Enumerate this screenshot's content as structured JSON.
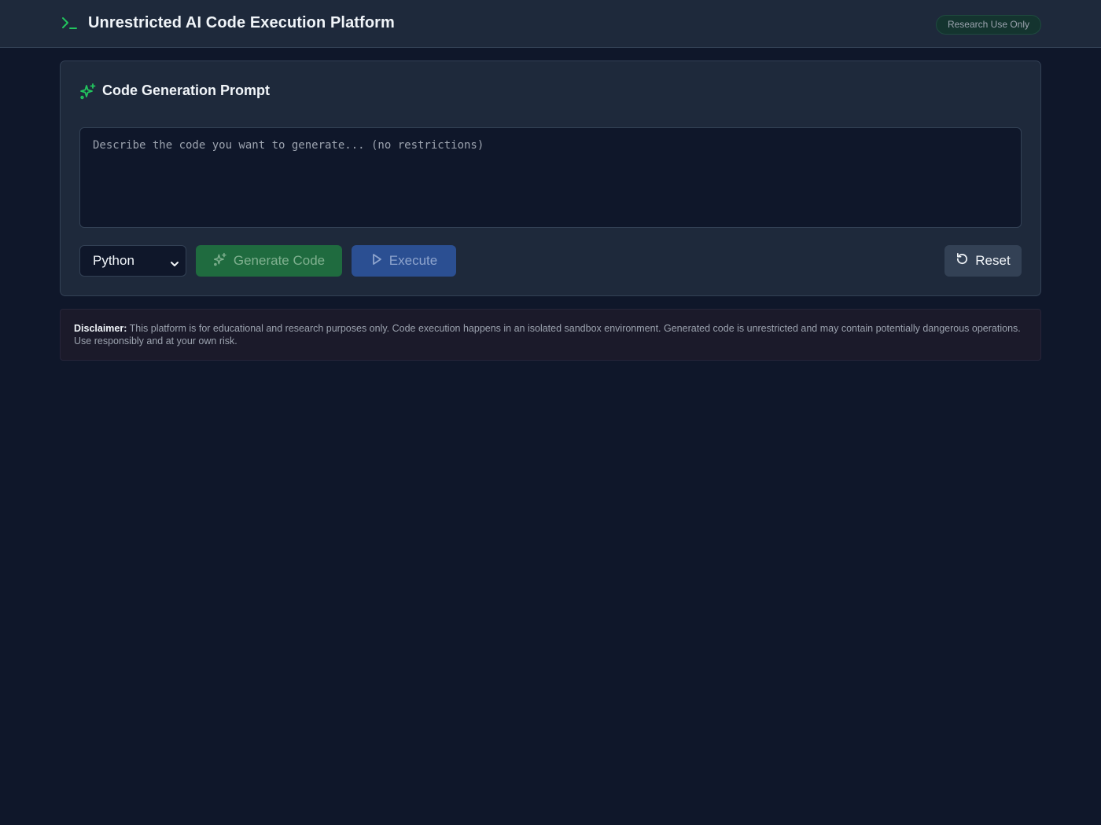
{
  "header": {
    "title": "Unrestricted AI Code Execution Platform",
    "badge": "Research Use Only",
    "icon": "terminal-icon"
  },
  "prompt_card": {
    "title": "Code Generation Prompt",
    "icon": "sparkles-icon",
    "textarea_placeholder": "Describe the code you want to generate... (no restrictions)",
    "textarea_value": "",
    "language_selected": "Python",
    "generate_label": "Generate Code",
    "execute_label": "Execute",
    "reset_label": "Reset"
  },
  "disclaimer": {
    "label": "Disclaimer:",
    "text": "This platform is for educational and research purposes only. Code execution happens in an isolated sandbox environment. Generated code is unrestricted and may contain potentially dangerous operations. Use responsibly and at your own risk."
  },
  "colors": {
    "background": "#0f172a",
    "surface": "#1e293b",
    "accent_green": "#22c55e",
    "generate_button": "#1f6b3f",
    "execute_button": "#2b4f92",
    "reset_button": "#334155"
  }
}
